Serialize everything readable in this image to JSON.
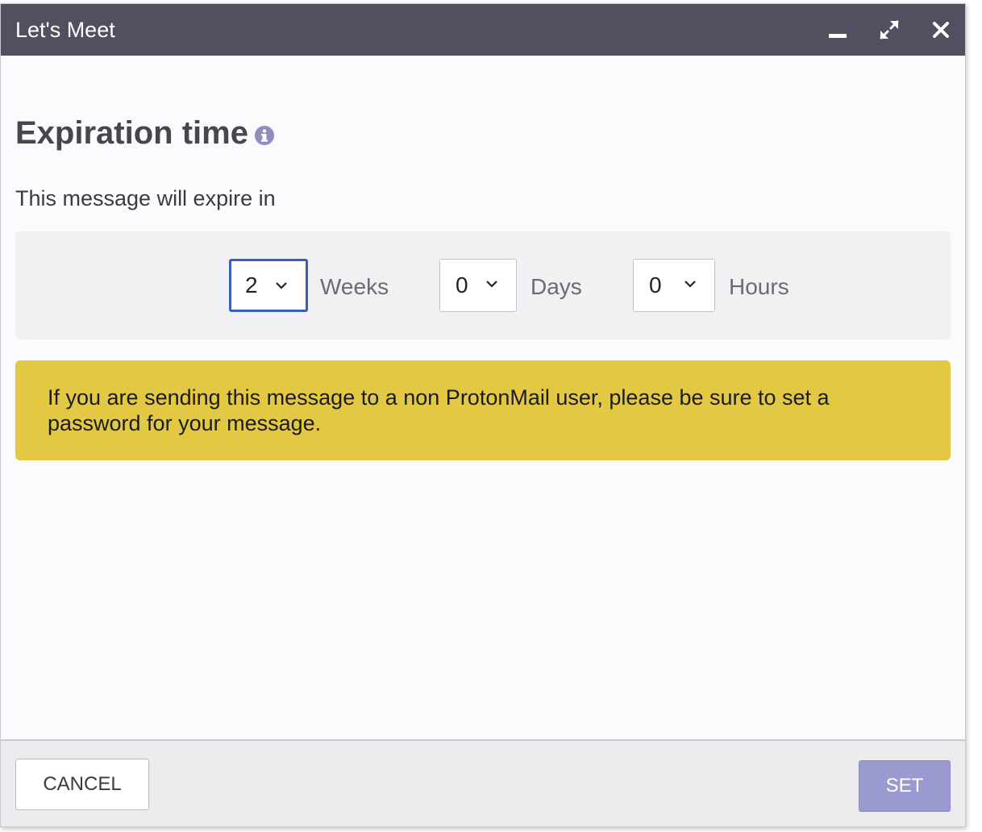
{
  "window": {
    "title": "Let's Meet",
    "controls": {
      "minimize": "minimize-icon",
      "maximize": "expand-icon",
      "close": "close-icon"
    }
  },
  "expiration": {
    "heading": "Expiration time",
    "info_icon": "info-icon",
    "subtitle": "This message will expire in",
    "weeks": {
      "value": "2",
      "unit": "Weeks"
    },
    "days": {
      "value": "0",
      "unit": "Days"
    },
    "hours": {
      "value": "0",
      "unit": "Hours"
    }
  },
  "warning": {
    "text": "If you are sending this message to a non ProtonMail user, please be sure to set a password for your message."
  },
  "footer": {
    "cancel_label": "CANCEL",
    "set_label": "SET"
  },
  "colors": {
    "titlebar": "#505061",
    "warning_bg": "#e2c843",
    "focus_border": "#3a5fb8",
    "set_button": "#9a9ad0",
    "info_icon": "#8d8dc0"
  }
}
